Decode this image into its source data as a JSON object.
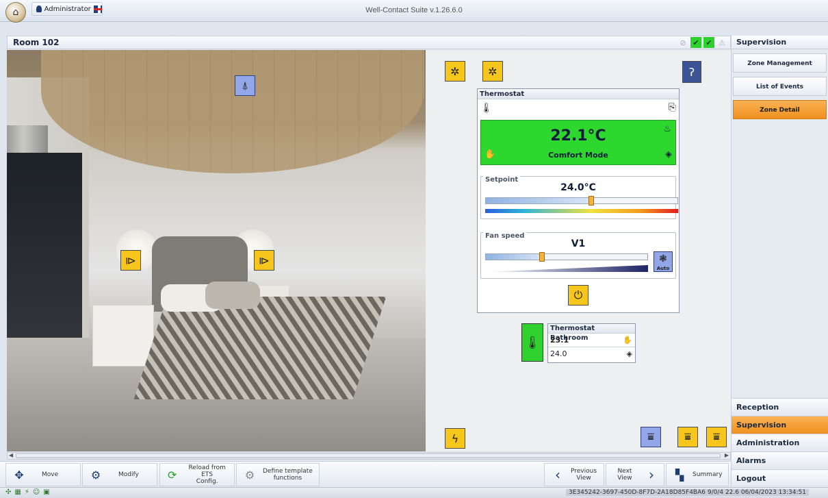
{
  "window": {
    "title": "Well-Contact Suite v.1.26.6.0",
    "user": "Administrator"
  },
  "room": {
    "title": "Room 102"
  },
  "thermostat": {
    "title": "Thermostat",
    "temperature": "22.1°C",
    "mode": "Comfort Mode",
    "setpoint_label": "Setpoint",
    "setpoint": "24.0°C",
    "setpoint_level": 0.55,
    "fan_label": "Fan speed",
    "fan": "V1",
    "fan_level": 0.35,
    "auto_label": "Auto"
  },
  "bathroom": {
    "title": "Thermostat Bathroom",
    "temperature": "23.1",
    "setpoint": "24.0"
  },
  "toolbar": {
    "move": "Move",
    "modify": "Modify",
    "reload_line1": "Reload from ETS",
    "reload_line2": "Config.",
    "define_line1": "Define template",
    "define_line2": "functions",
    "previous_line1": "Previous",
    "previous_line2": "View",
    "next": "Next View",
    "summary": "Summary"
  },
  "sidebar": {
    "header": "Supervision",
    "items": [
      {
        "label": "Zone Management",
        "active": false
      },
      {
        "label": "List of Events",
        "active": false
      },
      {
        "label": "Zone Detail",
        "active": true
      }
    ],
    "nav": [
      {
        "label": "Reception",
        "active": false
      },
      {
        "label": "Supervision",
        "active": true
      },
      {
        "label": "Administration",
        "active": false
      },
      {
        "label": "Alarms",
        "active": false
      },
      {
        "label": "Logout",
        "active": false
      }
    ]
  },
  "status": {
    "text": "3E345242-3697-450D-8F7D-2A18D85F4BA6 9/0/4 22.6 06/04/2023 13:34:51"
  },
  "colors": {
    "accent": "#f0901f",
    "comfort_green": "#2dd72d",
    "control_yellow": "#f7c61c",
    "control_blue": "#93a6e8"
  }
}
